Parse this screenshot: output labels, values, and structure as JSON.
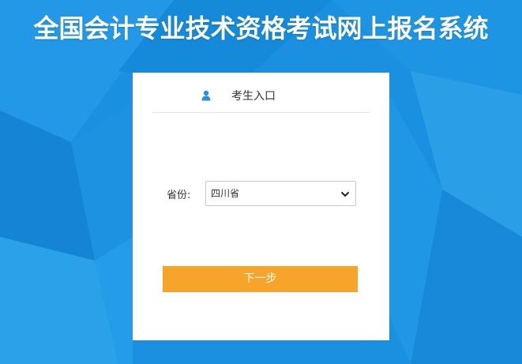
{
  "header": {
    "title": "全国会计专业技术资格考试网上报名系统"
  },
  "login_card": {
    "icon": "user-icon",
    "entry_title": "考生入口",
    "province_label": "省份:",
    "province_selected": "四川省",
    "next_button_label": "下一步"
  },
  "colors": {
    "background": "#1b8fe0",
    "button": "#f7a52a",
    "icon": "#2a8fdc"
  }
}
